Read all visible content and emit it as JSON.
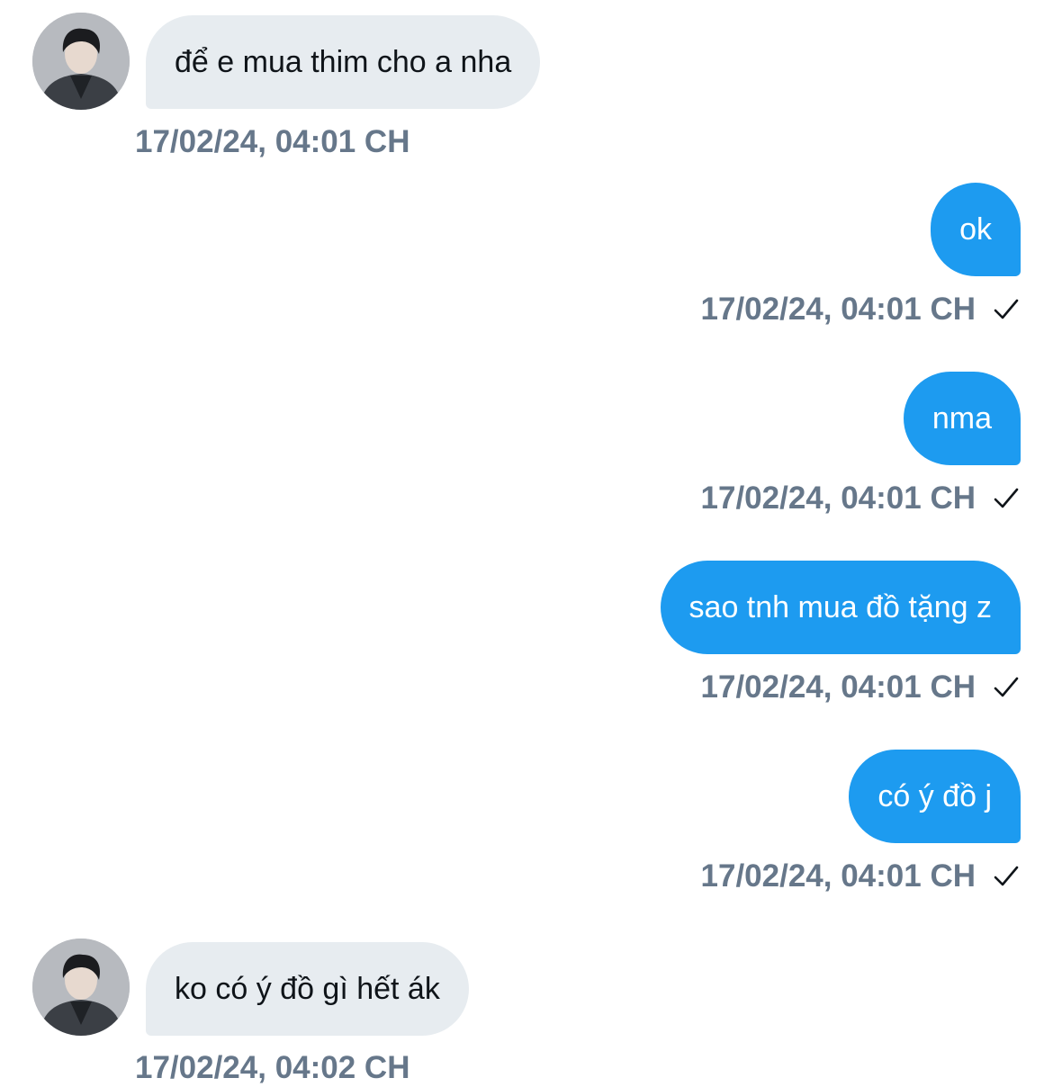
{
  "messages": [
    {
      "direction": "in",
      "text": "để e mua thim cho a nha",
      "timestamp": "17/02/24, 04:01 CH"
    },
    {
      "direction": "out",
      "text": "ok",
      "timestamp": "17/02/24, 04:01 CH",
      "status": "sent-check-icon"
    },
    {
      "direction": "out",
      "text": "nma",
      "timestamp": "17/02/24, 04:01 CH",
      "status": "sent-check-icon"
    },
    {
      "direction": "out",
      "text": "sao tnh mua đồ tặng z",
      "timestamp": "17/02/24, 04:01 CH",
      "status": "sent-check-icon"
    },
    {
      "direction": "out",
      "text": "có ý đồ j",
      "timestamp": "17/02/24, 04:01 CH",
      "status": "sent-check-icon"
    },
    {
      "direction": "in",
      "text": "ko có ý đồ gì hết ák",
      "timestamp": "17/02/24, 04:02 CH"
    }
  ],
  "colors": {
    "incoming_bubble": "#e7ecf0",
    "outgoing_bubble": "#1d9bf0",
    "timestamp": "#66778a"
  }
}
